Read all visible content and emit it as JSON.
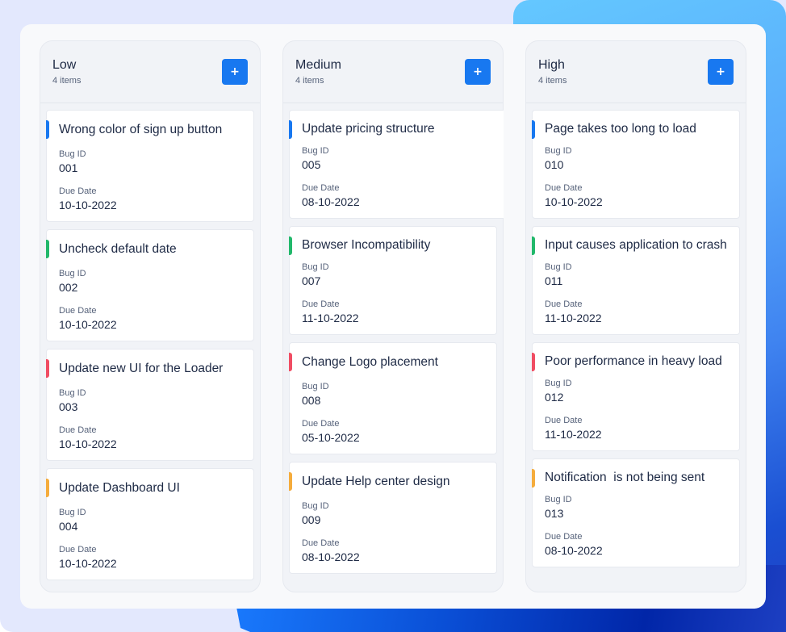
{
  "colors": {
    "accent_blue": "#1878f0",
    "accent_green": "#22b86b",
    "accent_red": "#f04d63",
    "accent_yellow": "#f5ac3c"
  },
  "columns": [
    {
      "title": "Low",
      "count": "4 items",
      "add_label": "+",
      "cards": [
        {
          "title": "Wrong color of sign up button",
          "bug_id_label": "Bug ID",
          "bug_id": "001",
          "due_label": "Due Date",
          "due_date": "10-10-2022",
          "accent": "blue"
        },
        {
          "title": "Uncheck default date",
          "bug_id_label": "Bug ID",
          "bug_id": "002",
          "due_label": "Due Date",
          "due_date": "10-10-2022",
          "accent": "green"
        },
        {
          "title": "Update new UI for the Loader",
          "bug_id_label": "Bug ID",
          "bug_id": "003",
          "due_label": "Due Date",
          "due_date": "10-10-2022",
          "accent": "red"
        },
        {
          "title": "Update Dashboard UI",
          "bug_id_label": "Bug ID",
          "bug_id": "004",
          "due_label": "Due Date",
          "due_date": "10-10-2022",
          "accent": "yellow"
        }
      ]
    },
    {
      "title": "Medium",
      "count": "4 items",
      "add_label": "+",
      "cards": [
        {
          "title": "Update pricing structure",
          "bug_id_label": "Bug ID",
          "bug_id": "005",
          "due_label": "Due Date",
          "due_date": "08-10-2022",
          "accent": "blue"
        },
        {
          "title": "Browser Incompatibility",
          "bug_id_label": "Bug ID",
          "bug_id": "007",
          "due_label": "Due Date",
          "due_date": "11-10-2022",
          "accent": "green"
        },
        {
          "title": "Change Logo placement",
          "bug_id_label": "Bug ID",
          "bug_id": "008",
          "due_label": "Due Date",
          "due_date": "05-10-2022",
          "accent": "red"
        },
        {
          "title": "Update Help center design",
          "bug_id_label": "Bug ID",
          "bug_id": "009",
          "due_label": "Due Date",
          "due_date": "08-10-2022",
          "accent": "yellow"
        }
      ]
    },
    {
      "title": "High",
      "count": "4 items",
      "add_label": "+",
      "cards": [
        {
          "title": "Page takes too long to load",
          "bug_id_label": "Bug ID",
          "bug_id": "010",
          "due_label": "Due Date",
          "due_date": "10-10-2022",
          "accent": "blue"
        },
        {
          "title": "Input causes application to crash",
          "bug_id_label": "Bug ID",
          "bug_id": "011",
          "due_label": "Due Date",
          "due_date": "11-10-2022",
          "accent": "green"
        },
        {
          "title": "Poor performance in heavy load",
          "bug_id_label": "Bug ID",
          "bug_id": "012",
          "due_label": "Due Date",
          "due_date": "11-10-2022",
          "accent": "red"
        },
        {
          "title": "Notification  is not being sent",
          "bug_id_label": "Bug ID",
          "bug_id": "013",
          "due_label": "Due Date",
          "due_date": "08-10-2022",
          "accent": "yellow"
        }
      ]
    }
  ]
}
